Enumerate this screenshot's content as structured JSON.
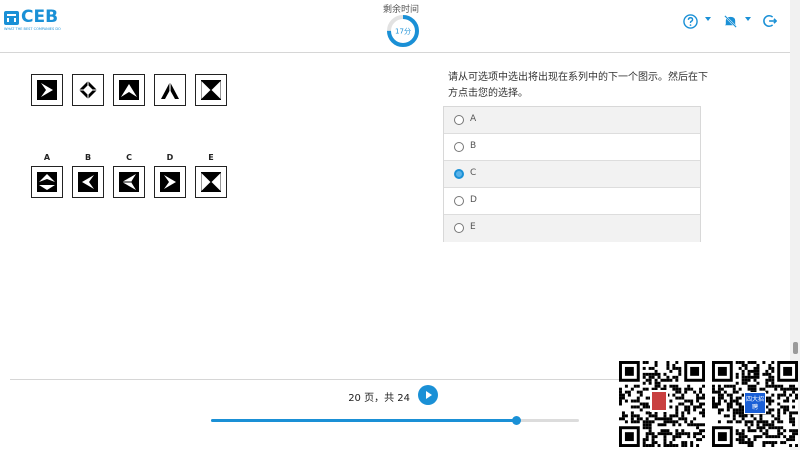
{
  "header": {
    "logo_text": "CEB",
    "logo_subtext": "WHAT THE BEST COMPANIES DO",
    "timer_label": "剩余时间",
    "timer_value": "17分",
    "timer_progress": 0.75,
    "accent": "#1a90d6",
    "icons": [
      "help-icon",
      "mute-icon",
      "exit-icon"
    ]
  },
  "series_tiles": [
    {
      "pattern": "arrow-right"
    },
    {
      "pattern": "diamond"
    },
    {
      "pattern": "arrow-up"
    },
    {
      "pattern": "arrow-up-split"
    },
    {
      "pattern": "hourglass"
    }
  ],
  "options": [
    {
      "letter": "A",
      "pattern": "arrow-up-left"
    },
    {
      "letter": "B",
      "pattern": "arrow-left"
    },
    {
      "letter": "C",
      "pattern": "arrow-left-b"
    },
    {
      "letter": "D",
      "pattern": "arrow-right"
    },
    {
      "letter": "E",
      "pattern": "hourglass"
    }
  ],
  "question": {
    "text": "请从可选项中选出将出现在系列中的下一个图示。然后在下方点击您的选择。",
    "choices": [
      {
        "label": "A",
        "checked": false
      },
      {
        "label": "B",
        "checked": false
      },
      {
        "label": "C",
        "checked": true
      },
      {
        "label": "D",
        "checked": false
      },
      {
        "label": "E",
        "checked": false
      }
    ]
  },
  "footer": {
    "page_text": "20 页，共 24",
    "current_page": 20,
    "total_pages": 24,
    "progress": 0.83
  },
  "qr_codes": [
    {
      "label": ""
    },
    {
      "label": "四大招聘"
    }
  ]
}
